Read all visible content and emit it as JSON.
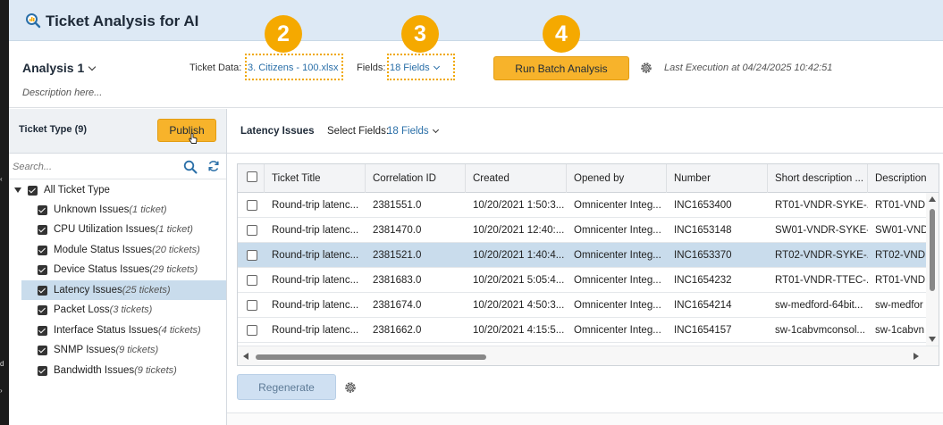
{
  "app": {
    "title": "Ticket Analysis for AI"
  },
  "header": {
    "analysis_name": "Analysis 1",
    "description_placeholder": "Description here...",
    "ticket_data_label": "Ticket Data:",
    "ticket_data_value": "3. Citizens - 100.xlsx",
    "fields_label": "Fields:",
    "fields_value": "18 Fields",
    "run_button": "Run Batch Analysis",
    "last_execution": "Last Execution at 04/24/2025 10:42:51"
  },
  "badges": [
    "2",
    "3",
    "4"
  ],
  "sidebar": {
    "title": "Ticket Type (9)",
    "publish_button": "Publish",
    "search_placeholder": "Search...",
    "root": "All Ticket Type",
    "items": [
      {
        "label": "Unknown Issues",
        "count": "(1 ticket)"
      },
      {
        "label": "CPU Utilization Issues",
        "count": "(1 ticket)"
      },
      {
        "label": "Module Status Issues",
        "count": "(20 tickets)"
      },
      {
        "label": "Device Status Issues",
        "count": "(29 tickets)"
      },
      {
        "label": "Latency Issues",
        "count": "(25 tickets)"
      },
      {
        "label": "Packet Loss",
        "count": "(3 tickets)"
      },
      {
        "label": "Interface Status Issues",
        "count": "(4 tickets)"
      },
      {
        "label": "SNMP Issues",
        "count": "(9 tickets)"
      },
      {
        "label": "Bandwidth Issues",
        "count": "(9 tickets)"
      }
    ]
  },
  "main": {
    "title": "Latency Issues",
    "select_fields_label": "Select Fields:",
    "select_fields_value": "18 Fields",
    "regenerate_button": "Regenerate"
  },
  "table": {
    "columns": [
      "Ticket Title",
      "Correlation ID",
      "Created",
      "Opened by",
      "Number",
      "Short description ...",
      "Description"
    ],
    "rows": [
      [
        "Round-trip latenc...",
        "2381551.0",
        "10/20/2021 1:50:3...",
        "Omnicenter Integ...",
        "INC1653400",
        "RT01-VNDR-SYKE-...",
        "RT01-VND"
      ],
      [
        "Round-trip latenc...",
        "2381470.0",
        "10/20/2021 12:40:...",
        "Omnicenter Integ...",
        "INC1653148",
        "SW01-VNDR-SYKE-...",
        "SW01-VND"
      ],
      [
        "Round-trip latenc...",
        "2381521.0",
        "10/20/2021 1:40:4...",
        "Omnicenter Integ...",
        "INC1653370",
        "RT02-VNDR-SYKE-...",
        "RT02-VND"
      ],
      [
        "Round-trip latenc...",
        "2381683.0",
        "10/20/2021 5:05:4...",
        "Omnicenter Integ...",
        "INC1654232",
        "RT01-VNDR-TTEC-...",
        "RT01-VND"
      ],
      [
        "Round-trip latenc...",
        "2381674.0",
        "10/20/2021 4:50:3...",
        "Omnicenter Integ...",
        "INC1654214",
        "sw-medford-64bit...",
        "sw-medfor"
      ],
      [
        "Round-trip latenc...",
        "2381662.0",
        "10/20/2021 4:15:5...",
        "Omnicenter Integ...",
        "INC1654157",
        "sw-1cabvmconsol...",
        "sw-1cabvn"
      ]
    ]
  },
  "colors": {
    "accent": "#f7b32b",
    "badge": "#f5a900",
    "selected_row": "#c9dcec",
    "title_bar": "#dde9f5",
    "link": "#2a6fa8"
  }
}
